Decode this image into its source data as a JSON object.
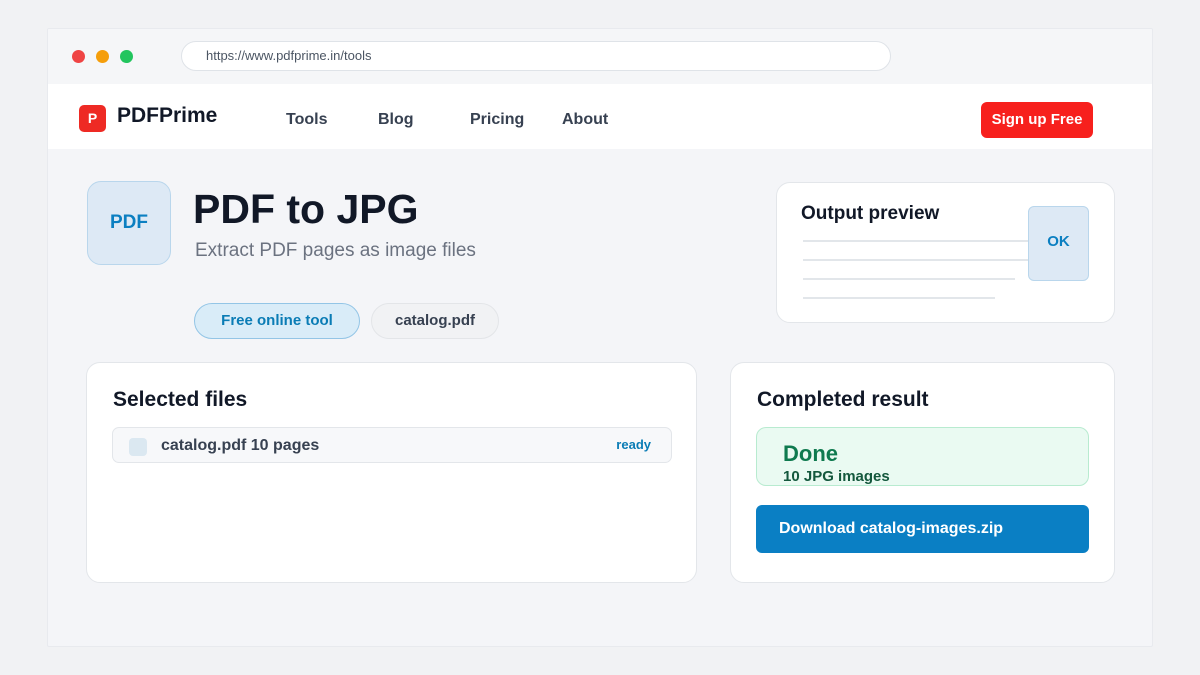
{
  "browser": {
    "url": "https://www.pdfprime.in/tools"
  },
  "navbar": {
    "logo_letter": "P",
    "brand": "PDFPrime",
    "links": [
      {
        "label": "Tools"
      },
      {
        "label": "Blog"
      },
      {
        "label": "Pricing"
      },
      {
        "label": "About"
      }
    ],
    "signup_label": "Sign up Free"
  },
  "hero": {
    "icon_label": "PDF",
    "title": "PDF to JPG",
    "subtitle": "Extract PDF pages as image files",
    "chips": [
      {
        "label": "Free online tool"
      },
      {
        "label": "catalog.pdf"
      }
    ]
  },
  "preview": {
    "title": "Output preview",
    "badge": "OK"
  },
  "selected_files": {
    "title": "Selected files",
    "items": [
      {
        "name": "catalog.pdf 10 pages",
        "status": "ready"
      }
    ]
  },
  "result": {
    "title": "Completed result",
    "status_title": "Done",
    "status_detail": "10 JPG images",
    "download_label": "Download catalog-images.zip"
  },
  "colors": {
    "brand_red": "#ee2a24",
    "signup_red": "#f7201d",
    "accent_blue": "#0a7fc4",
    "success_green": "#0f7a4f"
  }
}
